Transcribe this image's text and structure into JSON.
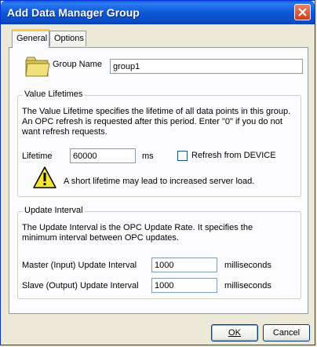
{
  "window": {
    "title": "Add Data Manager Group"
  },
  "tabs": [
    {
      "label": "General",
      "active": true
    },
    {
      "label": "Options",
      "active": false
    }
  ],
  "general": {
    "group_name_label": "Group Name",
    "group_name_value": "group1",
    "value_lifetimes": {
      "title": "Value Lifetimes",
      "description_line1": "The Value Lifetime specifies the lifetime of all data points in this group.",
      "description_line2": "An OPC refresh is requested after this period.  Enter \"0\" if you do not",
      "description_line3": "want refresh requests.",
      "lifetime_label": "Lifetime",
      "lifetime_value": "60000",
      "lifetime_unit": "ms",
      "refresh_checkbox_label": "Refresh from DEVICE",
      "refresh_checked": false,
      "warning_text": "A short lifetime may lead to increased server load."
    },
    "update_interval": {
      "title": "Update Interval",
      "description_line1": "The Update Interval is the OPC Update Rate.  It specifies the",
      "description_line2": "minimum interval between OPC updates.",
      "master_label": "Master (Input) Update Interval",
      "master_value": "1000",
      "master_unit": "milliseconds",
      "slave_label": "Slave (Output) Update Interval",
      "slave_value": "1000",
      "slave_unit": "milliseconds"
    }
  },
  "buttons": {
    "ok_label": "OK",
    "cancel_label": "Cancel"
  }
}
